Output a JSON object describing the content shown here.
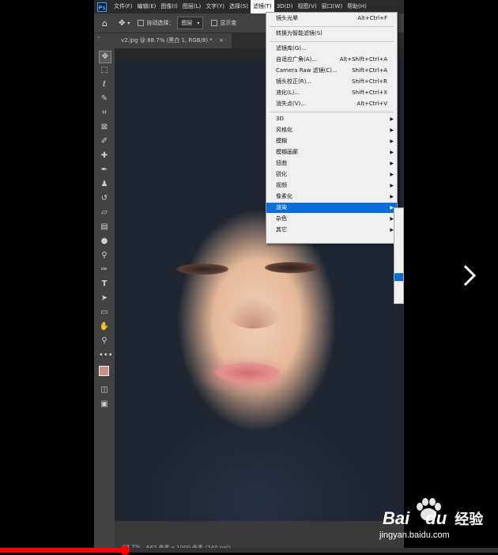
{
  "app": {
    "logo": "Ps",
    "menus": [
      "文件(F)",
      "编辑(E)",
      "图像(I)",
      "图层(L)",
      "文字(Y)",
      "选择(S)",
      "滤镜(T)",
      "3D(D)",
      "视图(V)",
      "窗口(W)",
      "帮助(H)"
    ],
    "active_menu_index": 6
  },
  "options_bar": {
    "auto_select_label": "自动选择：",
    "layer_select_value": "图层",
    "show_transform_label": "显示变"
  },
  "document": {
    "tab_title": "v2.jpg @ 88.7% (黑白 1, RGB/8) *",
    "close_glyph": "×"
  },
  "status": {
    "zoom": "88.7%",
    "dimensions": "667 像素 x 1000 像素 (240 ppi)"
  },
  "filter_menu": {
    "items": [
      {
        "label": "镜头光晕",
        "shortcut": "Alt+Ctrl+F"
      },
      {
        "separator": true
      },
      {
        "label": "转换为智能滤镜(S)",
        "shortcut": ""
      },
      {
        "separator": true
      },
      {
        "label": "滤镜库(G)...",
        "shortcut": ""
      },
      {
        "label": "自适应广角(A)...",
        "shortcut": "Alt+Shift+Ctrl+A"
      },
      {
        "label": "Camera Raw 滤镜(C)...",
        "shortcut": "Shift+Ctrl+A"
      },
      {
        "label": "镜头校正(R)...",
        "shortcut": "Shift+Ctrl+R"
      },
      {
        "label": "液化(L)...",
        "shortcut": "Shift+Ctrl+X"
      },
      {
        "label": "消失点(V)...",
        "shortcut": "Alt+Ctrl+V"
      },
      {
        "separator": true
      },
      {
        "label": "3D",
        "submenu": true
      },
      {
        "label": "风格化",
        "submenu": true
      },
      {
        "label": "模糊",
        "submenu": true
      },
      {
        "label": "模糊画廊",
        "submenu": true
      },
      {
        "label": "扭曲",
        "submenu": true
      },
      {
        "label": "锐化",
        "submenu": true
      },
      {
        "label": "视频",
        "submenu": true
      },
      {
        "label": "像素化",
        "submenu": true
      },
      {
        "label": "渲染",
        "submenu": true,
        "highlighted": true
      },
      {
        "label": "杂色",
        "submenu": true
      },
      {
        "label": "其它",
        "submenu": true
      }
    ]
  },
  "player": {
    "next_label": "›",
    "progress_fraction": 0.25
  },
  "watermark": {
    "brand": "Bai",
    "brand_mid": "du",
    "brand_cn": "经验",
    "url": "jingyan.baidu.com"
  },
  "colors": {
    "ps_dark": "#2b2b2b",
    "ps_panel": "#424242",
    "menu_highlight": "#0a6dd9",
    "foreground_swatch": "#c98f84",
    "baidu_red": "#de3b2f"
  }
}
